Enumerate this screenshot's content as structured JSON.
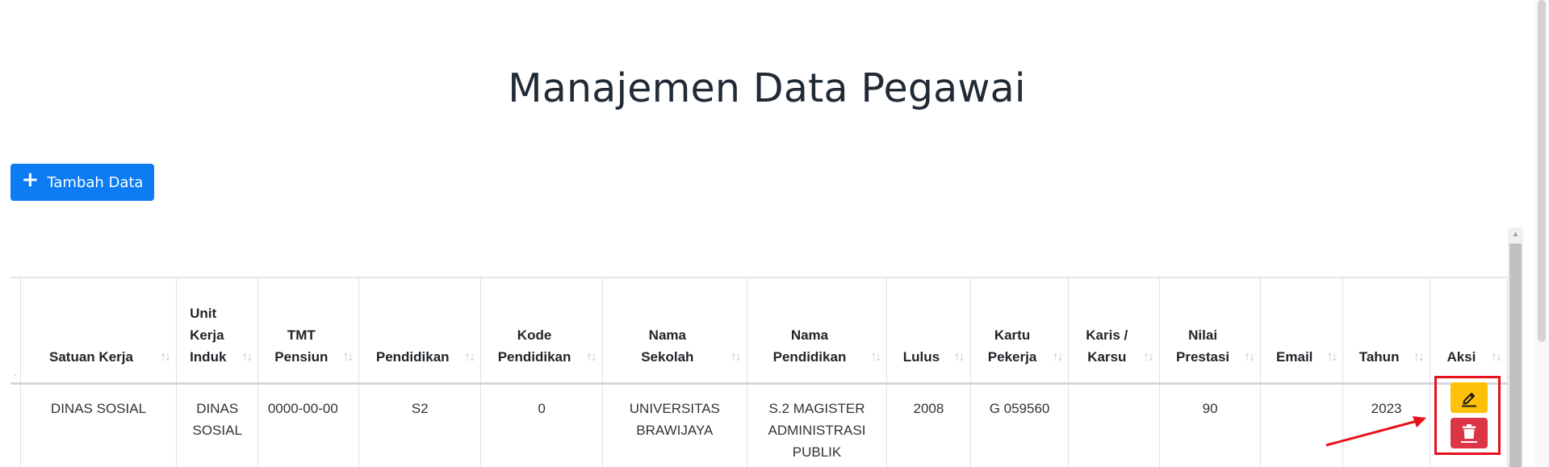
{
  "page": {
    "title": "Manajemen Data Pegawai"
  },
  "toolbar": {
    "add_label": "Tambah Data"
  },
  "table": {
    "columns": [
      {
        "label": ".",
        "sortable": false
      },
      {
        "label": "Satuan Kerja",
        "sortable": true
      },
      {
        "label": "Unit Kerja Induk",
        "sortable": true
      },
      {
        "label": "TMT Pensiun",
        "sortable": true
      },
      {
        "label": "Pendidikan",
        "sortable": true
      },
      {
        "label": "Kode Pendidikan",
        "sortable": true
      },
      {
        "label": "Nama Sekolah",
        "sortable": true
      },
      {
        "label": "Nama Pendidikan",
        "sortable": true
      },
      {
        "label": "Lulus",
        "sortable": true
      },
      {
        "label": "Kartu Pekerja",
        "sortable": true
      },
      {
        "label": "Karis / Karsu",
        "sortable": true
      },
      {
        "label": "Nilai Prestasi",
        "sortable": true
      },
      {
        "label": "Email",
        "sortable": true
      },
      {
        "label": "Tahun",
        "sortable": true
      },
      {
        "label": "Aksi",
        "sortable": true
      }
    ],
    "rows": [
      [
        "",
        "DINAS SOSIAL",
        "DINAS SOSIAL",
        "0000-00-00",
        "S2",
        "0",
        "UNIVERSITAS BRAWIJAYA",
        "S.2 MAGISTER ADMINISTRASI PUBLIK",
        "2008",
        "G 059560",
        "",
        "90",
        "",
        "2023"
      ]
    ]
  },
  "icons": {
    "add": "plus-icon",
    "edit": "pencil-icon",
    "delete": "trash-icon",
    "sort": "sort-arrows-icon"
  },
  "colors": {
    "primary": "#0d7cf2",
    "warning": "#ffc107",
    "danger": "#dc3545",
    "annotation": "#e8101b"
  }
}
